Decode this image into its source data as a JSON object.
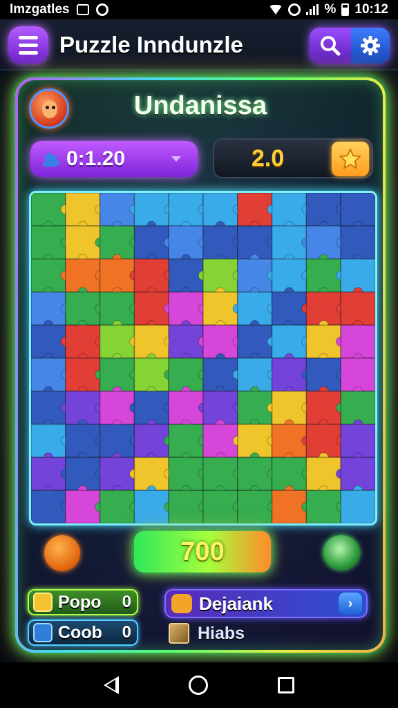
{
  "status_bar": {
    "app_name": "Imzgatles",
    "icons": [
      "gallery-icon",
      "circle-notification-icon",
      "wifi-icon",
      "alarm-icon",
      "signal-icon",
      "battery-icon"
    ],
    "percent_sign": "%",
    "time": "10:12"
  },
  "app_bar": {
    "title": "Puzzle Inndunzle",
    "menu_icon": "hamburger-menu-icon",
    "search_icon": "search-icon",
    "settings_icon": "gear-icon",
    "colors": {
      "menu": "#8a3ae8",
      "search": "#7a36e0",
      "settings": "#2a62d8"
    }
  },
  "player": {
    "name": "Undanissa",
    "avatar_icon": "player-avatar-icon"
  },
  "timer": {
    "value": "0:1.20",
    "icon": "puzzle-piece-icon"
  },
  "score_box": {
    "value": "2.0",
    "icon": "star-icon"
  },
  "board": {
    "rows": 10,
    "cols": 10,
    "palette": [
      "#2aa845",
      "#f0c21e",
      "#3a7fe6",
      "#e0322a",
      "#f06a18",
      "#d43bd6",
      "#2ea6e8",
      "#6c38d8",
      "#7fd12a",
      "#264fb8"
    ],
    "tiles": [
      [
        0,
        1,
        2,
        6,
        6,
        6,
        3,
        6,
        9,
        9
      ],
      [
        0,
        1,
        0,
        9,
        2,
        9,
        9,
        6,
        2,
        9
      ],
      [
        0,
        4,
        4,
        3,
        9,
        8,
        2,
        6,
        0,
        6
      ],
      [
        2,
        0,
        0,
        3,
        5,
        1,
        6,
        9,
        3,
        3
      ],
      [
        9,
        3,
        8,
        1,
        7,
        5,
        9,
        6,
        1,
        5
      ],
      [
        2,
        3,
        0,
        8,
        0,
        9,
        6,
        7,
        9,
        5
      ],
      [
        9,
        7,
        5,
        9,
        5,
        7,
        0,
        1,
        3,
        0
      ],
      [
        6,
        9,
        9,
        7,
        0,
        5,
        1,
        4,
        3,
        7
      ],
      [
        7,
        9,
        7,
        1,
        0,
        0,
        0,
        0,
        1,
        7
      ],
      [
        9,
        5,
        0,
        6,
        0,
        0,
        0,
        4,
        0,
        6
      ]
    ]
  },
  "bottom": {
    "score_total": "700",
    "left_icon": "coin-face-icon",
    "right_icon": "cup-icon",
    "popo": {
      "label": "Popo",
      "count": "0",
      "icon": "badge-icon"
    },
    "coob": {
      "label": "Coob",
      "count": "0",
      "icon": "card-icon"
    },
    "daily": {
      "label": "Dejaiank",
      "icon": "cat-icon",
      "go_icon": "arrow-right-icon"
    },
    "hints": {
      "label": "Hiabs",
      "icon": "map-icon"
    }
  },
  "nav": {
    "back_icon": "back-triangle-icon",
    "home_icon": "home-circle-icon",
    "recent_icon": "recent-square-icon"
  }
}
